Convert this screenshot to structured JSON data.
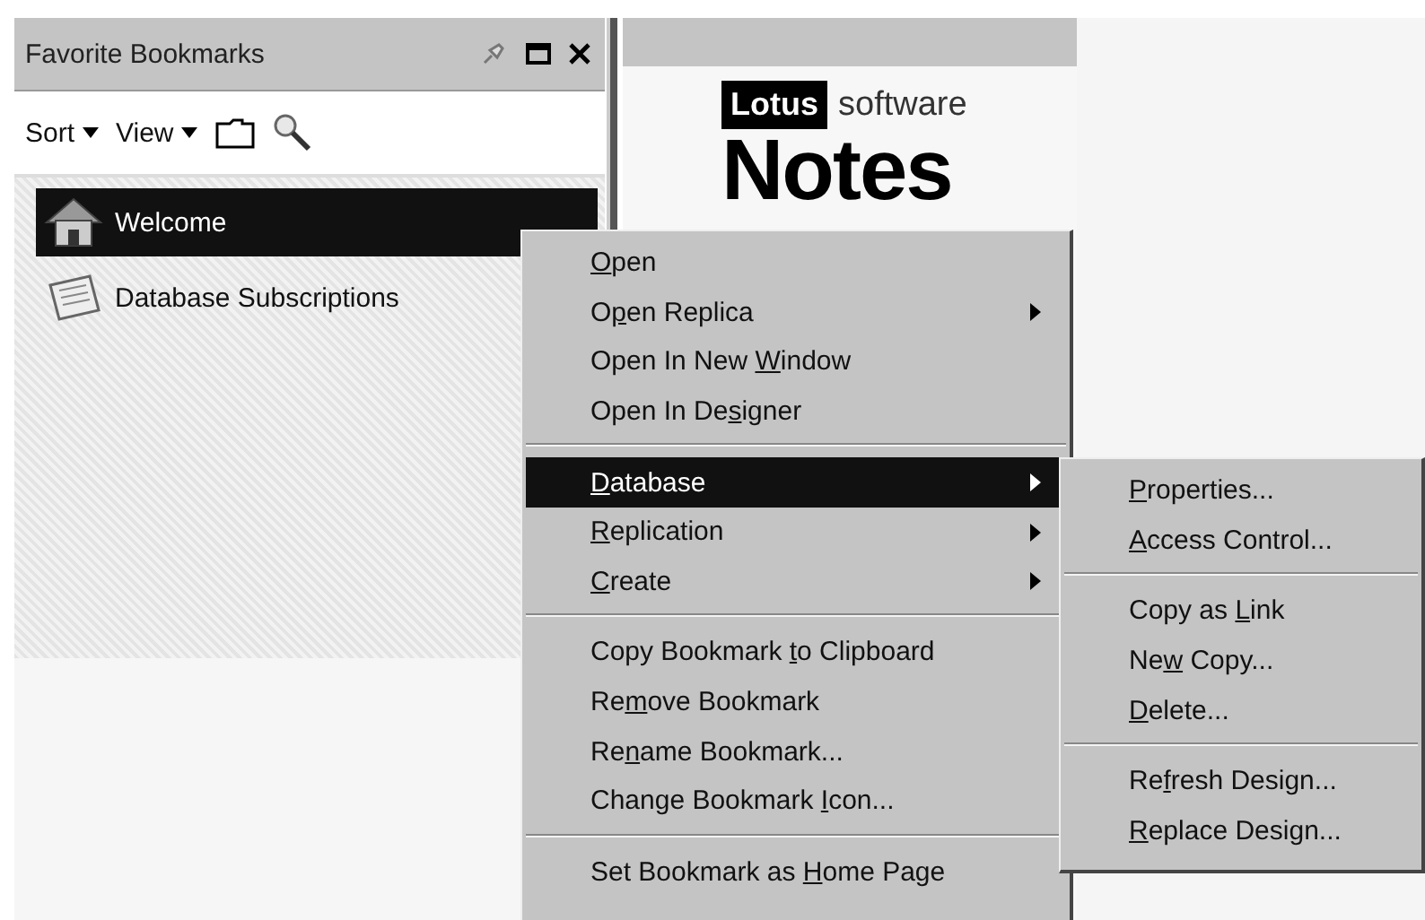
{
  "bookmarks_panel": {
    "title": "Favorite Bookmarks",
    "toolbar": [
      {
        "kind": "dropdown",
        "label": "Sort"
      },
      {
        "kind": "dropdown",
        "label": "View"
      },
      {
        "kind": "folder"
      },
      {
        "kind": "search"
      }
    ],
    "items": [
      {
        "label": "Welcome",
        "kind": "home",
        "selected": true
      },
      {
        "label": "Database Subscriptions",
        "kind": "subscriptions",
        "selected": false
      }
    ]
  },
  "welcome_page": {
    "brand": "Lotus",
    "brand_suffix": "software",
    "heading": "Notes"
  },
  "context_menu": [
    {
      "kind": "item",
      "key": "O",
      "post": "pen",
      "submenu": false,
      "selected": false
    },
    {
      "kind": "item",
      "pre": "O",
      "key": "p",
      "post": "en Replica",
      "submenu": true,
      "selected": false
    },
    {
      "kind": "item",
      "pre": "Open In New ",
      "key": "W",
      "post": "indow",
      "submenu": false,
      "selected": false
    },
    {
      "kind": "item",
      "pre": "Open In De",
      "key": "s",
      "post": "igner",
      "submenu": false,
      "selected": false
    },
    {
      "kind": "separator"
    },
    {
      "kind": "item",
      "key": "D",
      "post": "atabase",
      "submenu": true,
      "selected": true
    },
    {
      "kind": "item",
      "key": "R",
      "post": "eplication",
      "submenu": true,
      "selected": false
    },
    {
      "kind": "item",
      "key": "C",
      "post": "reate",
      "submenu": true,
      "selected": false
    },
    {
      "kind": "separator"
    },
    {
      "kind": "item",
      "pre": "Copy Bookmark ",
      "key": "t",
      "post": "o Clipboard",
      "submenu": false,
      "selected": false
    },
    {
      "kind": "item",
      "pre": "Re",
      "key": "m",
      "post": "ove Bookmark",
      "submenu": false,
      "selected": false
    },
    {
      "kind": "item",
      "pre": "Re",
      "key": "n",
      "post": "ame Bookmark...",
      "submenu": false,
      "selected": false
    },
    {
      "kind": "item",
      "pre": "Change Bookmark ",
      "key": "I",
      "post": "con...",
      "submenu": false,
      "selected": false
    },
    {
      "kind": "separator"
    },
    {
      "kind": "item",
      "pre": "Set Bookmark as ",
      "key": "H",
      "post": "ome Page",
      "submenu": false,
      "selected": false
    }
  ],
  "database_submenu": [
    {
      "kind": "item",
      "key": "P",
      "post": "roperties...",
      "submenu": false,
      "selected": false
    },
    {
      "kind": "item",
      "key": "A",
      "post": "ccess Control...",
      "submenu": false,
      "selected": false
    },
    {
      "kind": "separator"
    },
    {
      "kind": "item",
      "pre": "Copy as ",
      "key": "L",
      "post": "ink",
      "submenu": false,
      "selected": false
    },
    {
      "kind": "item",
      "pre": "Ne",
      "key": "w",
      "post": " Copy...",
      "submenu": false,
      "selected": false
    },
    {
      "kind": "item",
      "key": "D",
      "post": "elete...",
      "submenu": false,
      "selected": false
    },
    {
      "kind": "separator"
    },
    {
      "kind": "item",
      "pre": "Re",
      "key": "f",
      "post": "resh Design...",
      "submenu": false,
      "selected": false
    },
    {
      "kind": "item",
      "key": "R",
      "post": "eplace Design...",
      "submenu": false,
      "selected": false
    }
  ]
}
